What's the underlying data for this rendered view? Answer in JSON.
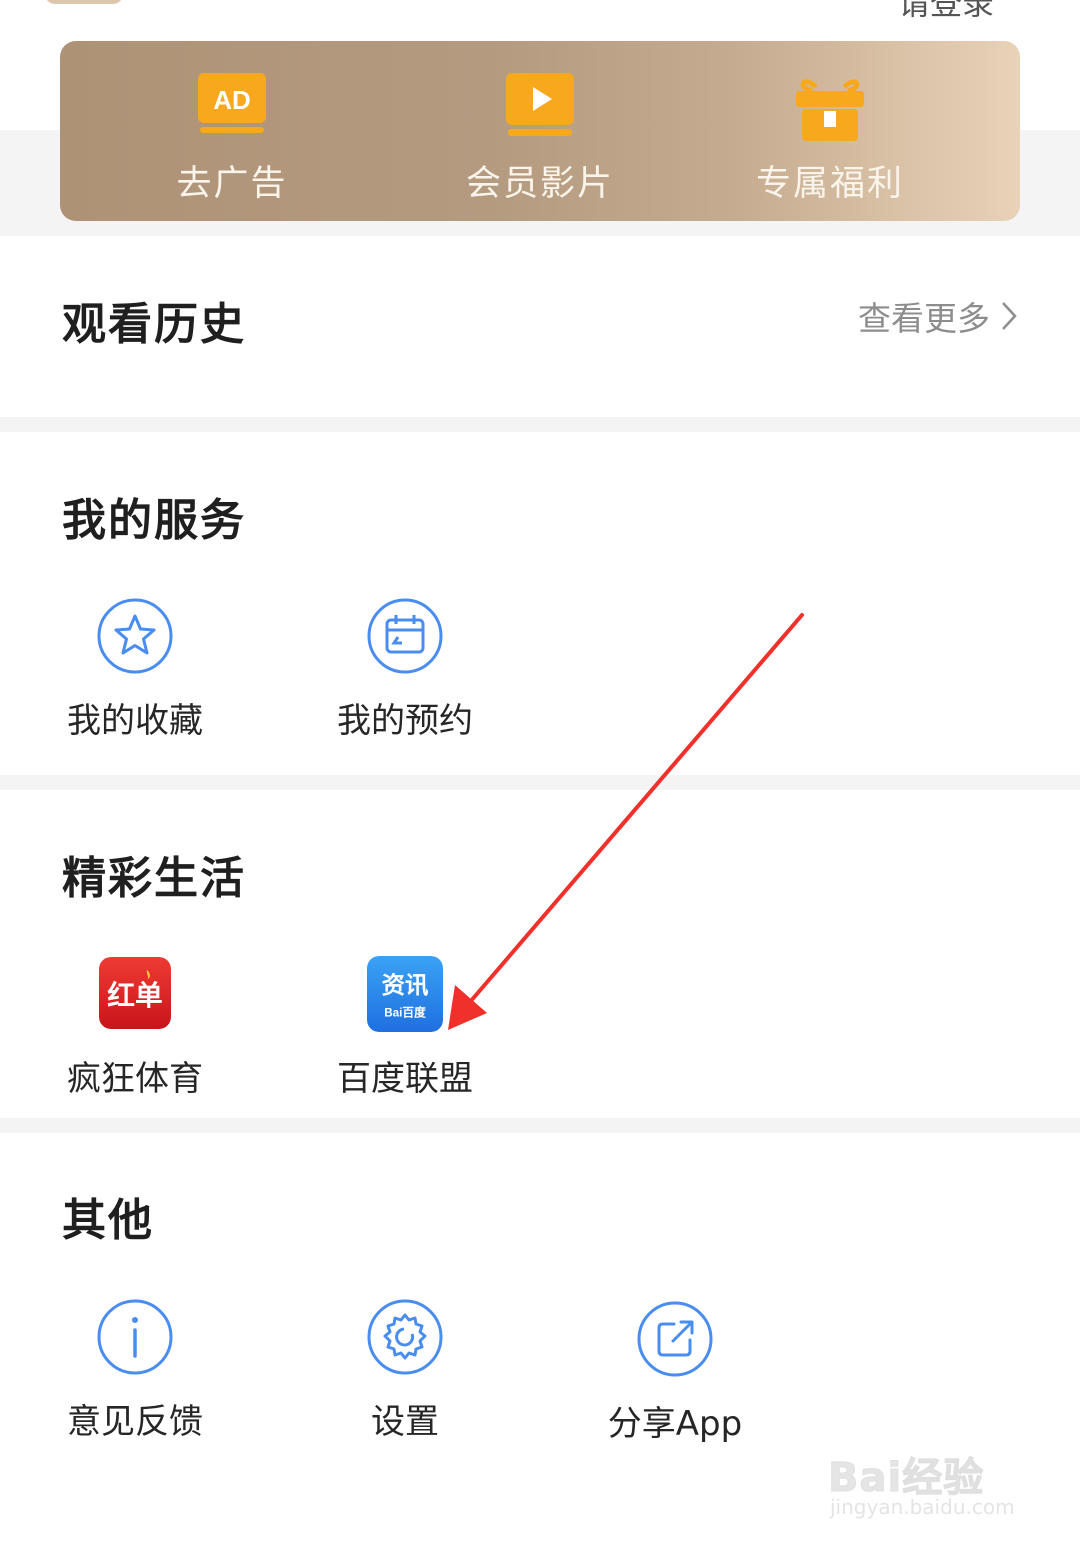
{
  "header": {
    "login_text": "请登录"
  },
  "vip_banner": {
    "items": [
      {
        "label": "去广告",
        "icon": "ad-icon"
      },
      {
        "label": "会员影片",
        "icon": "video-play-icon"
      },
      {
        "label": "专属福利",
        "icon": "gift-icon"
      }
    ],
    "ad_badge_text": "AD"
  },
  "history": {
    "title": "观看历史",
    "more_label": "查看更多"
  },
  "services": {
    "title": "我的服务",
    "items": [
      {
        "label": "我的收藏",
        "icon": "star-icon"
      },
      {
        "label": "我的预约",
        "icon": "calendar-icon"
      }
    ]
  },
  "life": {
    "title": "精彩生活",
    "items": [
      {
        "label": "疯狂体育",
        "icon": "hongdan-app-icon",
        "icon_text": "红单"
      },
      {
        "label": "百度联盟",
        "icon": "baidu-news-app-icon",
        "icon_text": "资讯",
        "icon_subtext": "Bai百度"
      }
    ]
  },
  "other": {
    "title": "其他",
    "items": [
      {
        "label": "意见反馈",
        "icon": "info-icon"
      },
      {
        "label": "设置",
        "icon": "gear-icon"
      },
      {
        "label": "分享App",
        "icon": "share-icon"
      }
    ]
  },
  "watermark": {
    "main": "Bai经验",
    "sub": "jingyan.baidu.com"
  },
  "colors": {
    "accent_blue": "#4a8df0",
    "annotation_red": "#f0312b",
    "banner_gold": "#f5a623"
  }
}
